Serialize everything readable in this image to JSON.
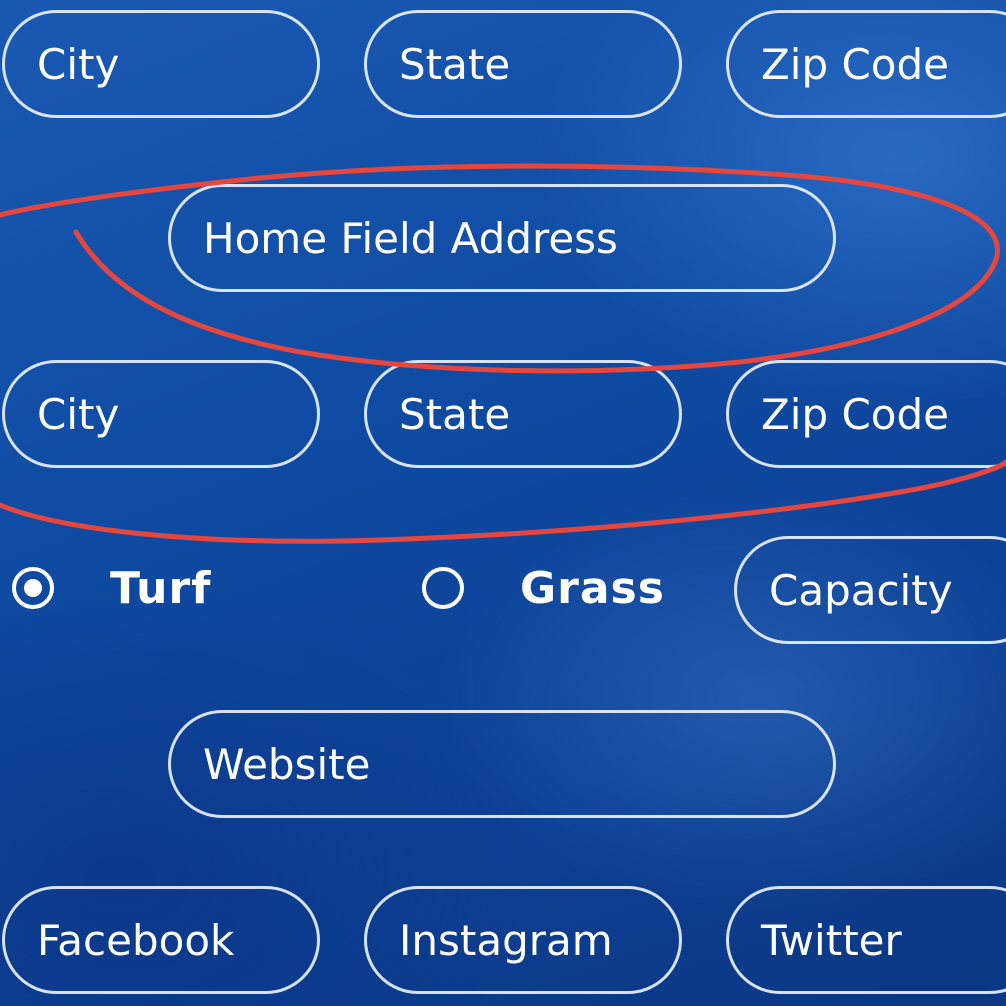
{
  "form": {
    "row1": {
      "city_placeholder": "City",
      "state_placeholder": "State",
      "zip_placeholder": "Zip Code"
    },
    "home_field_address_placeholder": "Home Field Address",
    "row2": {
      "city_placeholder": "City",
      "state_placeholder": "State",
      "zip_placeholder": "Zip Code"
    },
    "surface": {
      "options": [
        {
          "label": "Turf",
          "selected": true
        },
        {
          "label": "Grass",
          "selected": false
        }
      ]
    },
    "capacity_placeholder": "Capacity",
    "website_placeholder": "Website",
    "social": {
      "facebook_placeholder": "Facebook",
      "instagram_placeholder": "Instagram",
      "twitter_placeholder": "Twitter"
    }
  },
  "colors": {
    "background": "#0f4ba3",
    "field_border": "#e8f0fc",
    "text": "#ffffff",
    "annotation": "#e5473f"
  }
}
